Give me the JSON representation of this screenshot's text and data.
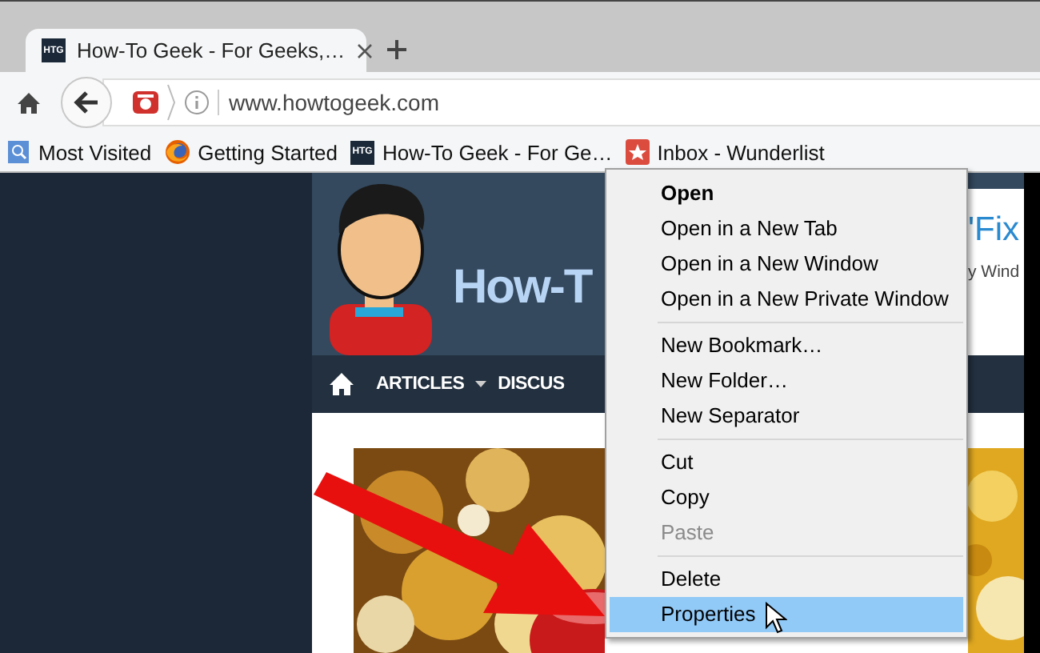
{
  "tab": {
    "favicon": "HTG",
    "title": "How-To Geek - For Geeks,…",
    "selected": true
  },
  "address_bar": {
    "url": "www.howtogeek.com"
  },
  "bookmarks": [
    {
      "label": "Most Visited",
      "kind": "folder"
    },
    {
      "label": "Getting Started",
      "kind": "firefox"
    },
    {
      "label": "How-To Geek - For Ge…",
      "kind": "htg",
      "favicon": "HTG"
    },
    {
      "label": "Inbox - Wunderlist",
      "kind": "wunderlist"
    }
  ],
  "page": {
    "site_title": "How-T",
    "nav_items": [
      "ARTICLES",
      "DISCUS"
    ],
    "headline": "'Fix",
    "subtitle": "y Wind"
  },
  "context_menu": [
    {
      "kind": "item",
      "label": "Open",
      "default": true,
      "disabled": false,
      "selected": false
    },
    {
      "kind": "item",
      "label": "Open in a New Tab",
      "default": false,
      "disabled": false,
      "selected": false
    },
    {
      "kind": "item",
      "label": "Open in a New Window",
      "default": false,
      "disabled": false,
      "selected": false
    },
    {
      "kind": "item",
      "label": "Open in a New Private Window",
      "default": false,
      "disabled": false,
      "selected": false
    },
    {
      "kind": "separator"
    },
    {
      "kind": "item",
      "label": "New Bookmark…",
      "default": false,
      "disabled": false,
      "selected": false
    },
    {
      "kind": "item",
      "label": "New Folder…",
      "default": false,
      "disabled": false,
      "selected": false
    },
    {
      "kind": "item",
      "label": "New Separator",
      "default": false,
      "disabled": false,
      "selected": false
    },
    {
      "kind": "separator"
    },
    {
      "kind": "item",
      "label": "Cut",
      "default": false,
      "disabled": false,
      "selected": false
    },
    {
      "kind": "item",
      "label": "Copy",
      "default": false,
      "disabled": false,
      "selected": false
    },
    {
      "kind": "item",
      "label": "Paste",
      "default": false,
      "disabled": true,
      "selected": false
    },
    {
      "kind": "separator"
    },
    {
      "kind": "item",
      "label": "Delete",
      "default": false,
      "disabled": false,
      "selected": false
    },
    {
      "kind": "item",
      "label": "Properties",
      "default": false,
      "disabled": false,
      "selected": true
    }
  ]
}
